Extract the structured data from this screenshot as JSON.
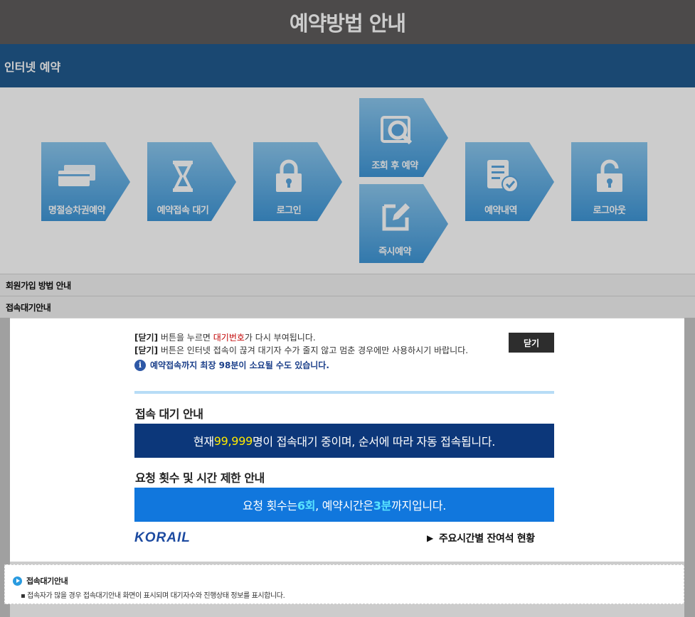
{
  "title": "예약방법 안내",
  "section": "인터넷 예약",
  "steps": [
    {
      "label": "명절승차권예약",
      "icon": "ticket-icon"
    },
    {
      "label": "예약접속 대기",
      "icon": "hourglass-icon"
    },
    {
      "label": "로그인",
      "icon": "lock-icon"
    },
    {
      "label": "조회 후 예약",
      "icon": "search-icon"
    },
    {
      "label": "즉시예약",
      "icon": "edit-icon"
    },
    {
      "label": "예약내역",
      "icon": "document-check-icon"
    },
    {
      "label": "로그아웃",
      "icon": "unlock-icon"
    }
  ],
  "accordion": {
    "signup": "회원가입 방법 안내",
    "waiting": "접속대기안내"
  },
  "popup": {
    "close_bracket": "[닫기]",
    "line1_a": " 버튼을 누르면 ",
    "line1_red": "대기번호",
    "line1_b": "가 다시 부여됩니다.",
    "line2": " 버튼은 인터넷 접속이 끊겨 대기자 수가 줄지 않고 멈춘 경우에만 사용하시기 바랍니다.",
    "info": "예약접속까지 최장 98분이 소요될 수도 있습니다.",
    "close_button": "닫기",
    "wait_heading": "접속 대기 안내",
    "wait_a": "현재 ",
    "wait_count": "99,999",
    "wait_b": "명이 접속대기 중이며, 순서에 따라 자동 접속됩니다.",
    "limit_heading": "요청 횟수 및 시간 제한 안내",
    "limit_a": "요청 횟수는 ",
    "limit_count": "6회",
    "limit_b": ", 예약시간은 ",
    "limit_time": "3분",
    "limit_c": "까지입니다.",
    "logo": "KORAIL",
    "seat_link": "주요시간별 잔여석 현황"
  },
  "bottom": {
    "title": "접속대기안내",
    "desc": "▪ 접속자가 많을 경우 접속대기안내 화면이 표시되며 대기자수와 진행상태 정보를 표시합니다."
  },
  "colors": {
    "step_light": "#8cc8ef",
    "step_dark": "#3f97d8",
    "wait_box": "#0c377a",
    "limit_box": "#1177dd",
    "section_bar": "#215a8f"
  }
}
